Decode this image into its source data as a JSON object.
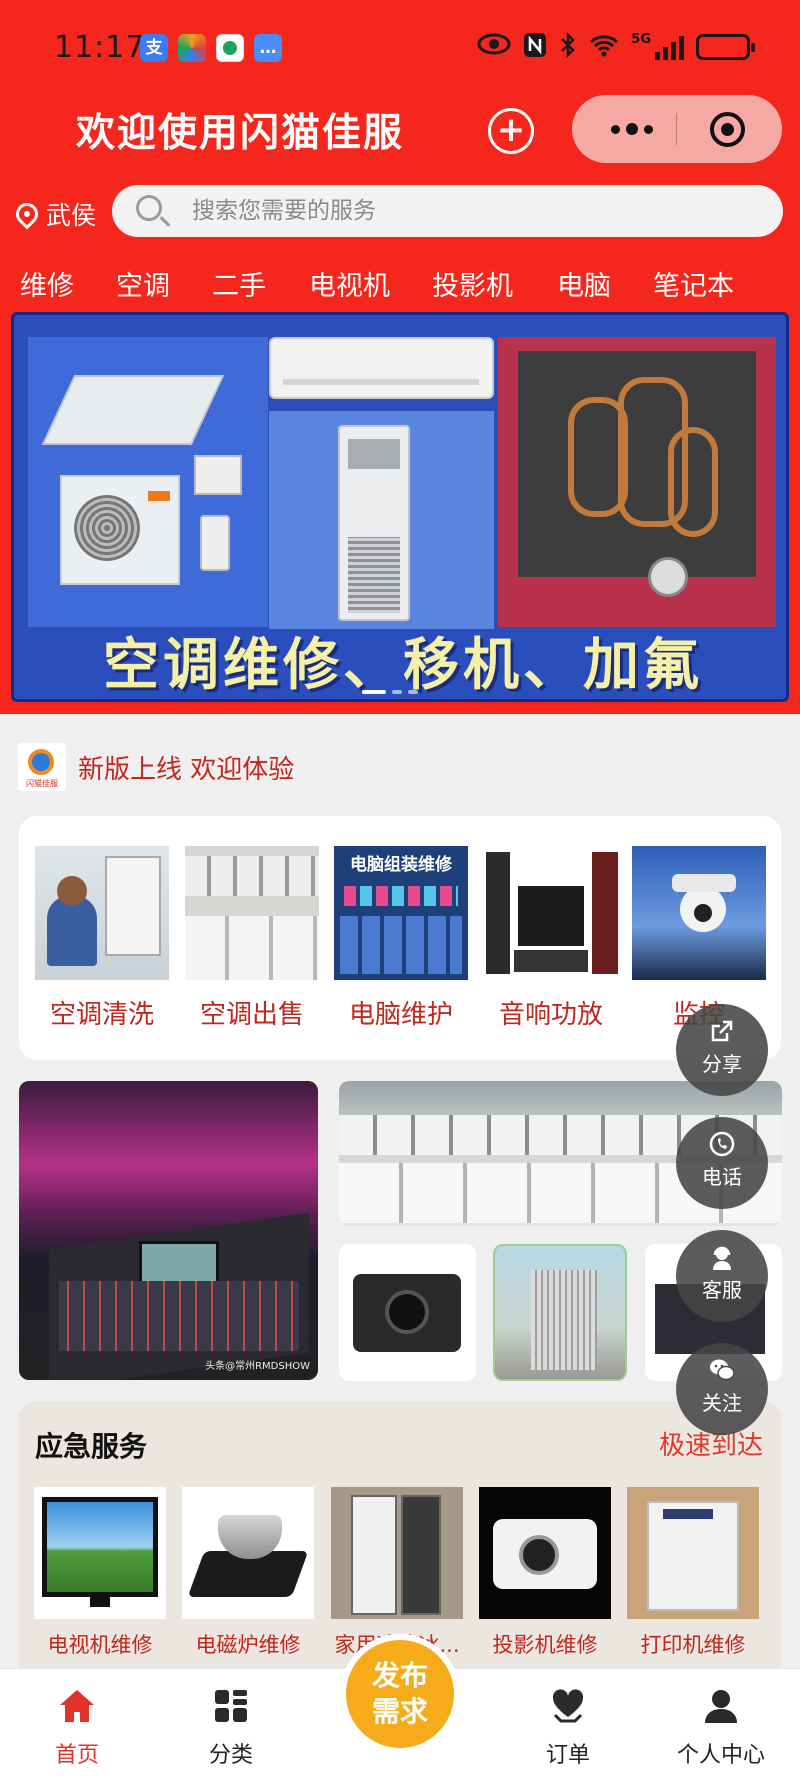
{
  "status_bar": {
    "time": "11:17",
    "apps": [
      {
        "name": "alipay-icon",
        "glyph": "支",
        "color": "#3b7cf5"
      },
      {
        "name": "photos-icon",
        "glyph": "",
        "color": "#f0a020"
      },
      {
        "name": "china-mobile-icon",
        "glyph": "",
        "color": "#1aa260"
      },
      {
        "name": "messages-icon",
        "glyph": "…",
        "color": "#4a8cf5"
      }
    ],
    "network": "5G"
  },
  "header": {
    "title": "欢迎使用闪猫佳服",
    "location": "武侯",
    "search_placeholder": "搜索您需要的服务"
  },
  "categories": [
    "维修",
    "空调",
    "二手",
    "电视机",
    "投影机",
    "电脑",
    "笔记本"
  ],
  "banner": {
    "text": "空调维修、移机、加氟",
    "slide_count": 3,
    "active_slide": 0
  },
  "notice": {
    "logo_text": "闪猫佳服",
    "text": "新版上线 欢迎体验"
  },
  "services": [
    {
      "label": "空调清洗"
    },
    {
      "label": "空调出售"
    },
    {
      "label": "电脑维护",
      "image_text": "电脑组装维修"
    },
    {
      "label": "音响功放"
    },
    {
      "label": "监控"
    }
  ],
  "photo_watermark": "头条@常州RMDSHOW",
  "emergency": {
    "title": "应急服务",
    "subtitle": "极速到达",
    "items": [
      {
        "label": "电视机维修"
      },
      {
        "label": "电磁炉维修"
      },
      {
        "label": "家用冰箱冰..."
      },
      {
        "label": "投影机维修"
      },
      {
        "label": "打印机维修"
      }
    ]
  },
  "floating_actions": [
    {
      "label": "分享",
      "icon": "share-icon"
    },
    {
      "label": "电话",
      "icon": "phone-icon"
    },
    {
      "label": "客服",
      "icon": "customer-service-icon"
    },
    {
      "label": "关注",
      "icon": "wechat-icon"
    }
  ],
  "tabbar": {
    "items": [
      {
        "label": "首页",
        "icon": "home-icon",
        "active": true
      },
      {
        "label": "分类",
        "icon": "grid-icon",
        "active": false
      },
      {
        "label": "订单",
        "icon": "order-heart-icon",
        "active": false
      },
      {
        "label": "个人中心",
        "icon": "user-icon",
        "active": false
      }
    ],
    "publish_label": "发布需求"
  },
  "colors": {
    "brand_red": "#f5261b",
    "accent_red": "#c0271d",
    "publish_orange": "#f6ab1b",
    "page_bg": "#efefef"
  }
}
